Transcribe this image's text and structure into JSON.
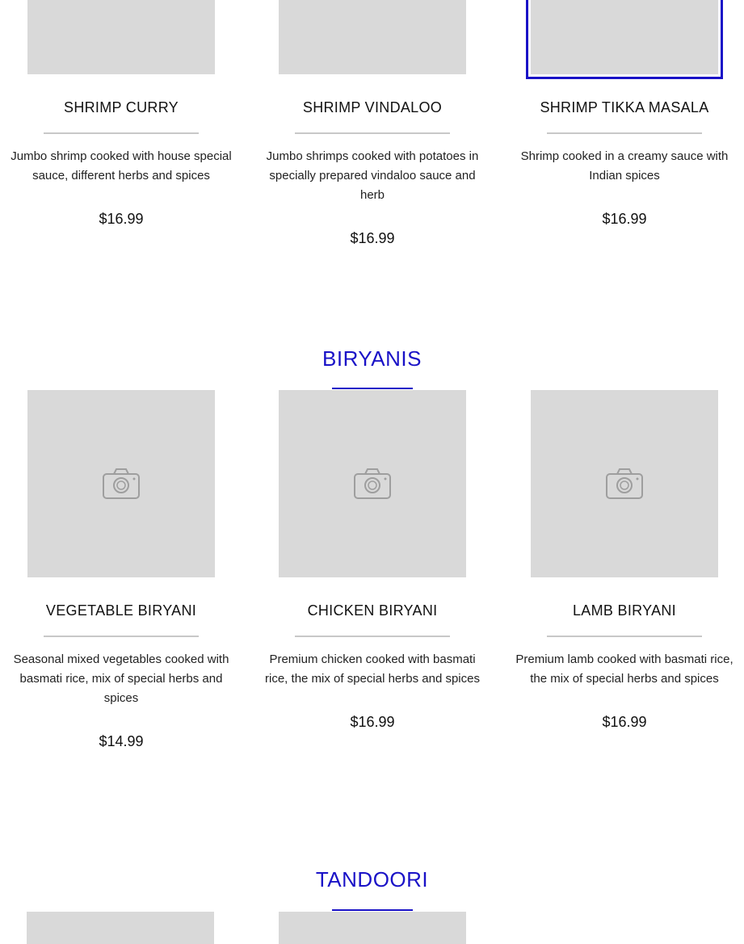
{
  "shrimp_row": {
    "items": [
      {
        "name": "SHRIMP CURRY",
        "description": "Jumbo shrimp cooked with house special sauce, different herbs and spices",
        "price": "$16.99"
      },
      {
        "name": "SHRIMP VINDALOO",
        "description": "Jumbo shrimps cooked with potatoes in specially prepared vindaloo sauce and herb",
        "price": "$16.99"
      },
      {
        "name": "SHRIMP TIKKA MASALA",
        "description": "Shrimp cooked in a creamy sauce with Indian spices",
        "price": "$16.99"
      }
    ]
  },
  "biryanis": {
    "title": "BIRYANIS",
    "items": [
      {
        "name": "VEGETABLE BIRYANI",
        "description": "Seasonal mixed vegetables cooked with basmati rice, mix of special herbs and spices",
        "price": "$14.99"
      },
      {
        "name": "CHICKEN BIRYANI",
        "description": "Premium chicken cooked with basmati rice, the mix of special herbs and spices",
        "price": "$16.99"
      },
      {
        "name": "LAMB BIRYANI",
        "description": "Premium lamb cooked with basmati rice, the mix of special herbs and spices",
        "price": "$16.99"
      }
    ]
  },
  "tandoori": {
    "title": "TANDOORI"
  },
  "colors": {
    "accent": "#1a12c7",
    "placeholder": "#d9d9d9",
    "divider": "#c8c8c8"
  },
  "icons": {
    "image_placeholder": "camera-icon"
  }
}
